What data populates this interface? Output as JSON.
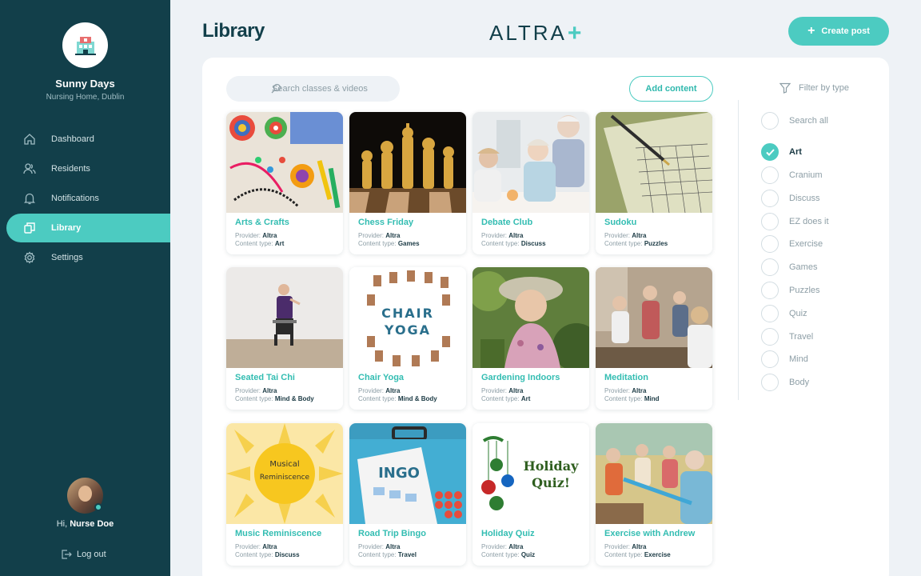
{
  "org": {
    "name": "Sunny Days",
    "subtitle": "Nursing Home, Dublin",
    "logo_icon": "building-icon"
  },
  "nav": [
    {
      "label": "Dashboard",
      "icon": "home-icon",
      "active": false
    },
    {
      "label": "Residents",
      "icon": "users-icon",
      "active": false
    },
    {
      "label": "Notifications",
      "icon": "bell-icon",
      "active": false
    },
    {
      "label": "Library",
      "icon": "library-icon",
      "active": true
    },
    {
      "label": "Settings",
      "icon": "gear-icon",
      "active": false
    }
  ],
  "user": {
    "greeting": "Hi,",
    "name": "Nurse Doe",
    "logout_label": "Log out"
  },
  "header": {
    "title": "Library",
    "brand": "ALTRA",
    "brand_plus": "+",
    "create_label": "Create post"
  },
  "search": {
    "placeholder": "Search classes & videos"
  },
  "add_content_label": "Add content",
  "labels": {
    "provider": "Provider:",
    "content_type": "Content type:"
  },
  "cards": [
    {
      "title": "Arts & Crafts",
      "provider": "Altra",
      "type": "Art",
      "image": "craft-supplies"
    },
    {
      "title": "Chess Friday",
      "provider": "Altra",
      "type": "Games",
      "image": "chess-pieces"
    },
    {
      "title": "Debate Club",
      "provider": "Altra",
      "type": "Discuss",
      "image": "seniors-talking"
    },
    {
      "title": "Sudoku",
      "provider": "Altra",
      "type": "Puzzles",
      "image": "sudoku-grid"
    },
    {
      "title": "Seated Tai Chi",
      "provider": "Altra",
      "type": "Mind & Body",
      "image": "tai-chi"
    },
    {
      "title": "Chair Yoga",
      "provider": "Altra",
      "type": "Mind & Body",
      "image": "chair-yoga",
      "image_text": [
        "CHAIR",
        "YOGA"
      ]
    },
    {
      "title": "Gardening Indoors",
      "provider": "Altra",
      "type": "Art",
      "image": "gardening"
    },
    {
      "title": "Meditation",
      "provider": "Altra",
      "type": "Mind",
      "image": "meditation-group"
    },
    {
      "title": "Music Reminiscence",
      "provider": "Altra",
      "type": "Discuss",
      "image": "music-sun",
      "image_text": [
        "Musical",
        "Reminiscence"
      ]
    },
    {
      "title": "Road Trip Bingo",
      "provider": "Altra",
      "type": "Travel",
      "image": "bingo-cards",
      "image_text": [
        "INGO"
      ]
    },
    {
      "title": "Holiday Quiz",
      "provider": "Altra",
      "type": "Quiz",
      "image": "holiday-ornaments",
      "image_text": [
        "Holiday",
        "Quiz!"
      ]
    },
    {
      "title": "Exercise with Andrew",
      "provider": "Altra",
      "type": "Exercise",
      "image": "exercise-class"
    }
  ],
  "filter": {
    "label": "Filter by type",
    "options": [
      {
        "label": "Search all",
        "checked": false
      },
      {
        "label": "Art",
        "checked": true
      },
      {
        "label": "Cranium",
        "checked": false
      },
      {
        "label": "Discuss",
        "checked": false
      },
      {
        "label": "EZ does it",
        "checked": false
      },
      {
        "label": "Exercise",
        "checked": false
      },
      {
        "label": "Games",
        "checked": false
      },
      {
        "label": "Puzzles",
        "checked": false
      },
      {
        "label": "Quiz",
        "checked": false
      },
      {
        "label": "Travel",
        "checked": false
      },
      {
        "label": "Mind",
        "checked": false
      },
      {
        "label": "Body",
        "checked": false
      }
    ]
  },
  "colors": {
    "sidebar": "#123f4a",
    "accent": "#4ccbc1",
    "background": "#eef2f6"
  }
}
